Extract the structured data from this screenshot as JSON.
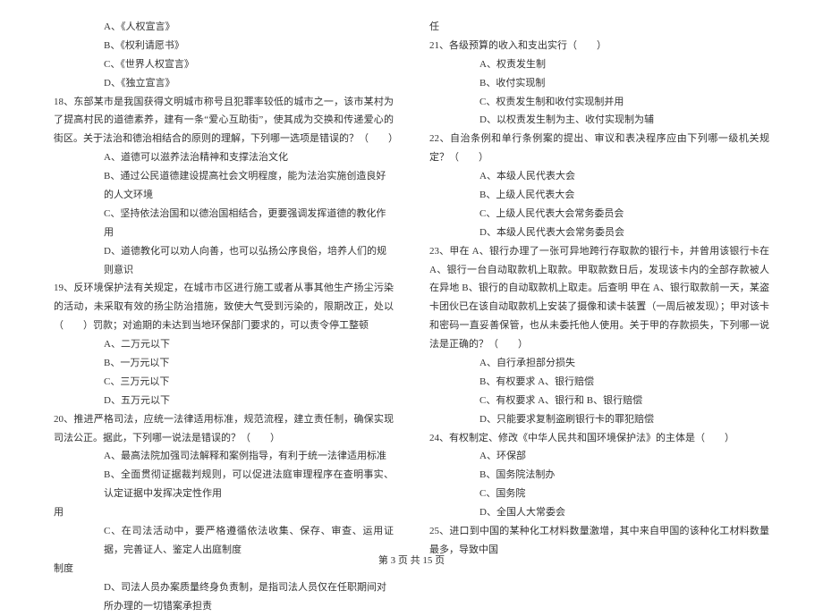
{
  "left": {
    "q17": {
      "opts": {
        "A": "A、《人权宣言》",
        "B": "B、《权利请愿书》",
        "C": "C、《世界人权宣言》",
        "D": "D、《独立宣言》"
      }
    },
    "q18": {
      "stem": "18、东部某市是我国获得文明城市称号且犯罪率较低的城市之一，该市某村为了提高村民的道德素养，建有一条“爱心互助街”，使其成为交换和传递爱心的街区。关于法治和德治相结合的原则的理解，下列哪一选项是错误的？（　　）",
      "opts": {
        "A": "A、道德可以滋养法治精神和支撑法治文化",
        "B": "B、通过公民道德建设提高社会文明程度，能为法治实施创造良好的人文环境",
        "C": "C、坚持依法治国和以德治国相结合，更要强调发挥道德的教化作用",
        "D": "D、道德教化可以劝人向善，也可以弘扬公序良俗，培养人们的规则意识"
      }
    },
    "q19": {
      "stem": "19、反环境保护法有关规定，在城市市区进行施工或者从事其他生产扬尘污染的活动，未采取有效的扬尘防治措施，致使大气受到污染的，限期改正，处以（　　）罚款；对逾期的未达到当地环保部门要求的，可以责令停工整顿",
      "opts": {
        "A": "A、二万元以下",
        "B": "B、一万元以下",
        "C": "C、三万元以下",
        "D": "D、五万元以下"
      }
    },
    "q20": {
      "stem": "20、推进严格司法，应统一法律适用标准，规范流程，建立责任制，确保实现司法公正。据此，下列哪一说法是错误的？（　　）",
      "opts": {
        "A": "A、最高法院加强司法解释和案例指导，有利于统一法律适用标准",
        "B": "B、全面贯彻证据裁判规则，可以促进法庭审理程序在查明事实、认定证据中发挥决定性作用",
        "C": "C、在司法活动中，要严格遵循依法收集、保存、审查、运用证据，完善证人、鉴定人出庭制度",
        "D": "D、司法人员办案质量终身负责制，是指司法人员仅在任职期间对所办理的一切错案承担责"
      }
    }
  },
  "right": {
    "q20_tail": "任",
    "q21": {
      "stem": "21、各级预算的收入和支出实行（　　）",
      "opts": {
        "A": "A、权责发生制",
        "B": "B、收付实现制",
        "C": "C、权责发生制和收付实现制并用",
        "D": "D、以权责发生制为主、收付实现制为辅"
      }
    },
    "q22": {
      "stem": "22、自治条例和单行条例案的提出、审议和表决程序应由下列哪一级机关规定？（　　）",
      "opts": {
        "A": "A、本级人民代表大会",
        "B": "B、上级人民代表大会",
        "C": "C、上级人民代表大会常务委员会",
        "D": "D、本级人民代表大会常务委员会"
      }
    },
    "q23": {
      "stem": "23、甲在 A、银行办理了一张可异地跨行存取款的银行卡，并曾用该银行卡在 A、银行一台自动取款机上取款。甲取款数日后，发现该卡内的全部存款被人在异地 B、银行的自动取款机上取走。后查明 甲在 A、银行取款前一天，某盗卡团伙已在该自动取款机上安装了摄像和读卡装置（一周后被发现）；甲对该卡和密码一直妥善保管，也从未委托他人使用。关于甲的存款损失，下列哪一说法是正确的？（　　）",
      "opts": {
        "A": "A、自行承担部分损失",
        "B": "B、有权要求 A、银行赔偿",
        "C": "C、有权要求 A、银行和 B、银行赔偿",
        "D": "D、只能要求复制盗刷银行卡的罪犯赔偿"
      }
    },
    "q24": {
      "stem": "24、有权制定、修改《中华人民共和国环境保护法》的主体是（　　）",
      "opts": {
        "A": "A、环保部",
        "B": "B、国务院法制办",
        "C": "C、国务院",
        "D": "D、全国人大常委会"
      }
    },
    "q25": {
      "stem": "25、进口到中国的某种化工材料数量激增，其中来自甲国的该种化工材料数量最多，导致中国"
    }
  },
  "footer": "第 3 页 共 15 页"
}
